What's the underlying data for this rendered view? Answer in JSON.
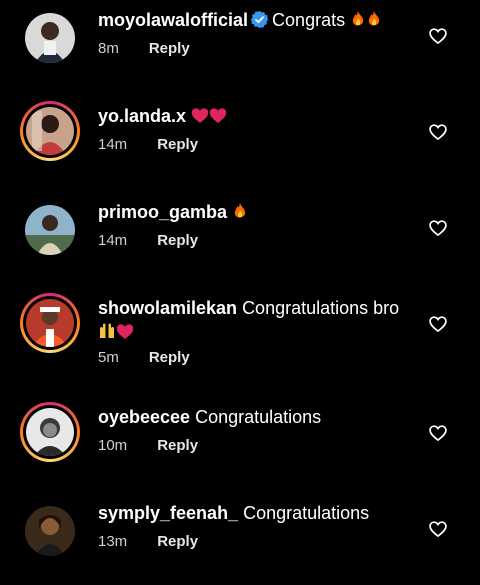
{
  "comments": [
    {
      "username": "moyolawalofficial",
      "verified": true,
      "text": "Congrats",
      "emoji": "fire fire",
      "time": "8m",
      "reply": "Reply"
    },
    {
      "username": "yo.landa.x",
      "verified": false,
      "text": "",
      "emoji": "heart heart",
      "time": "14m",
      "reply": "Reply"
    },
    {
      "username": "primoo_gamba",
      "verified": false,
      "text": "",
      "emoji": "fire",
      "time": "14m",
      "reply": "Reply"
    },
    {
      "username": "showolamilekan",
      "verified": false,
      "text": "Congratulations bro",
      "emoji": "raised-hands heart",
      "time": "5m",
      "reply": "Reply"
    },
    {
      "username": "oyebeecee",
      "verified": false,
      "text": "Congratulations",
      "emoji": "",
      "time": "10m",
      "reply": "Reply"
    },
    {
      "username": "symply_feenah_",
      "verified": false,
      "text": "Congratulations",
      "emoji": "",
      "time": "13m",
      "reply": "Reply"
    }
  ],
  "icons": {
    "like": "heart-outline-icon",
    "verified": "verified-badge-icon"
  },
  "colors": {
    "background": "#000000",
    "verified": "#3897f0",
    "fire": "#ff6a00",
    "heart": "#e0245e"
  }
}
